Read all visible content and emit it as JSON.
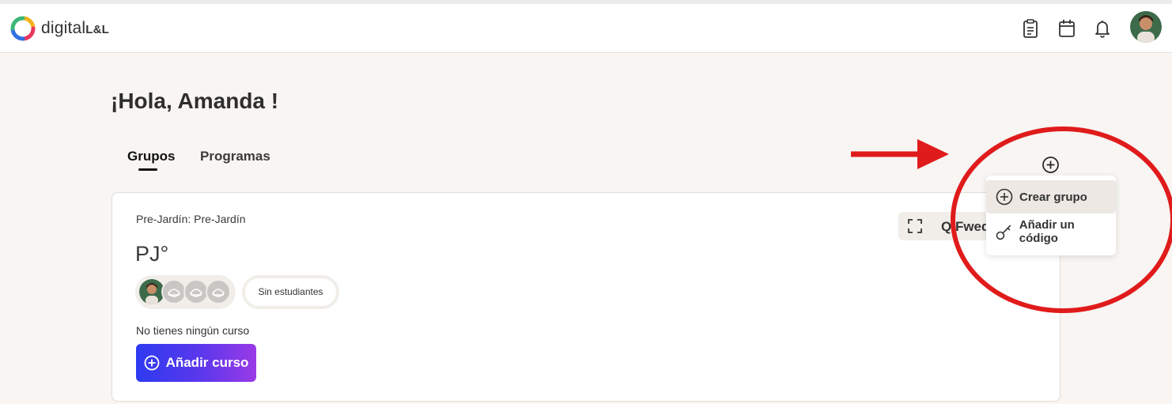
{
  "header": {
    "logo_main": "digital",
    "logo_suffix": "L&L",
    "icons": [
      "clipboard-icon",
      "calendar-icon",
      "bell-icon"
    ],
    "avatar_alt": "user-avatar"
  },
  "greeting": "¡Hola, Amanda !",
  "tabs": [
    {
      "label": "Grupos",
      "active": true
    },
    {
      "label": "Programas",
      "active": false
    }
  ],
  "group_card": {
    "subtitle": "Pre-Jardín: Pre-Jardín",
    "title": "PJ°",
    "students_label": "Sin estudiantes",
    "no_course_text": "No tienes ningún curso",
    "add_course_label": "Añadir curso",
    "code_label": "Q Fwed"
  },
  "dropdown": {
    "items": [
      {
        "label": "Crear grupo",
        "icon": "plus-circle-icon"
      },
      {
        "label": "Añadir un código",
        "icon": "key-icon"
      }
    ]
  },
  "colors": {
    "accent_start": "#2d3af0",
    "accent_end": "#9a3ae6",
    "annotation": "#e01b1b",
    "background": "#f8f5f2"
  }
}
